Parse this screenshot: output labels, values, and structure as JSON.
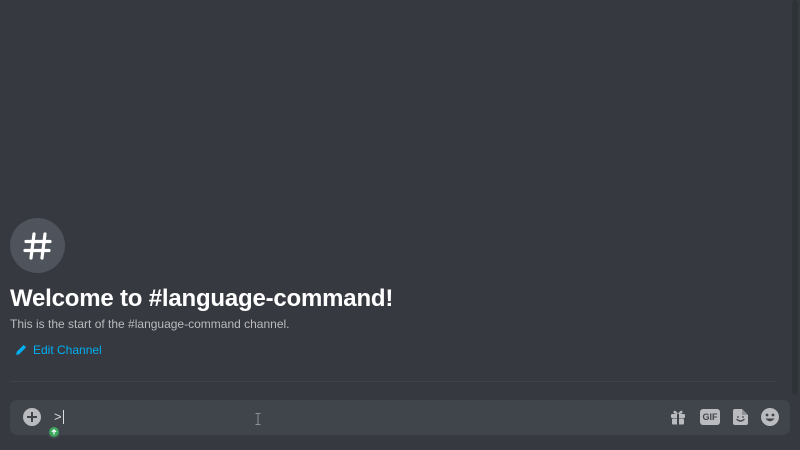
{
  "welcome": {
    "title": "Welcome to #language-command!",
    "subtitle": "This is the start of the #language-command channel.",
    "edit_label": "Edit Channel",
    "avatar_icon": "hashtag-icon"
  },
  "composer": {
    "input_value": ">",
    "toolbar": {
      "gift_icon": "gift-icon",
      "gif_label": "GIF",
      "sticker_icon": "sticker-icon",
      "emoji_icon": "emoji-icon"
    }
  },
  "colors": {
    "background": "#36393f",
    "composer_bg": "#40444b",
    "link": "#00aff4",
    "title": "#ffffff",
    "muted": "#b9bbbe",
    "badge_green": "#3ba55d"
  }
}
